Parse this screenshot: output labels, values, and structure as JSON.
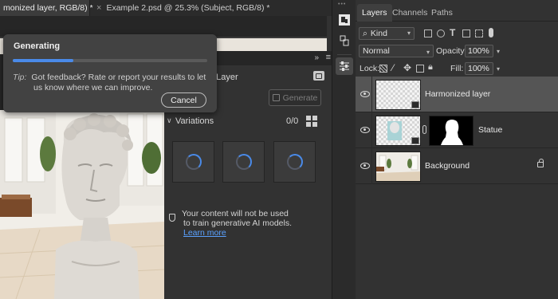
{
  "tabs": [
    {
      "label": "monized layer, RGB/8) *",
      "active": true
    },
    {
      "label": "Example 2.psd @ 25.3% (Subject, RGB/8) *",
      "active": false
    }
  ],
  "dialog": {
    "title": "Generating",
    "progress": 0.31,
    "tip_label": "Tip:",
    "tip_text_line1": "Got feedback? Rate or report your results to let",
    "tip_text_line2": "us know where we can improve.",
    "cancel_label": "Cancel"
  },
  "gen_panel": {
    "title": "n Layer",
    "generate_label": "Generate",
    "variations_label": "Variations",
    "variations_count": "0/0",
    "notice_line1": "Your content will not be used",
    "notice_line2": "to train generative AI models.",
    "learn_more": "Learn more"
  },
  "layers_panel": {
    "tabs": [
      "Layers",
      "Channels",
      "Paths"
    ],
    "kind_label": "Kind",
    "blend_mode": "Normal",
    "opacity_label": "Opacity:",
    "opacity_value": "100%",
    "lock_label": "Lock:",
    "fill_label": "Fill:",
    "fill_value": "100%",
    "layers": [
      {
        "name": "Harmonized layer",
        "selected": true
      },
      {
        "name": "Statue",
        "selected": false
      },
      {
        "name": "Background",
        "selected": false
      }
    ]
  },
  "colors": {
    "accent": "#4a8ae8",
    "link": "#5aa1ff",
    "panel": "#323232",
    "dialog": "#424242"
  },
  "icons": [
    "close-icon",
    "chevron-double-right-icon",
    "panel-menu-icon",
    "new-layer-icon",
    "generate-icon",
    "chevron-down-icon",
    "grid-view-icon",
    "spinner-icon",
    "shield-icon",
    "eye-icon",
    "chain-link-icon",
    "lock-icon",
    "smart-object-icon",
    "search-icon",
    "image-filter-icon",
    "adjustment-filter-icon",
    "type-filter-icon",
    "shape-filter-icon",
    "smart-filter-icon",
    "toggle-filter-icon"
  ]
}
